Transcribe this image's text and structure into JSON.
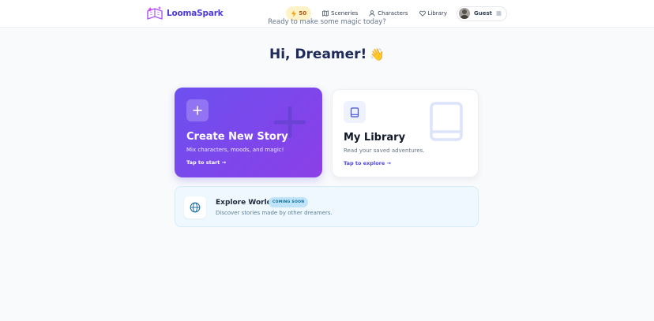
{
  "app": {
    "name": "LoomaSpark"
  },
  "header": {
    "energy_count": "50",
    "nav": [
      {
        "label": "Sceneries",
        "icon": "map-icon"
      },
      {
        "label": "Characters",
        "icon": "user-icon"
      },
      {
        "label": "Library",
        "icon": "heart-icon"
      }
    ],
    "user": {
      "name": "Guest",
      "menu_icon": "hamburger-icon"
    }
  },
  "greeting": {
    "title": "Hi, Dreamer!",
    "emoji": "👋",
    "subtitle": "Ready to make some magic today?"
  },
  "cards": {
    "create": {
      "title": "Create New Story",
      "description": "Mix characters, moods, and magic!",
      "cta": "Tap to start →",
      "icon": "plus-icon"
    },
    "library": {
      "title": "My Library",
      "description": "Read your saved adventures.",
      "cta": "Tap to explore →",
      "icon": "book-icon"
    }
  },
  "explore": {
    "title": "Explore Worlds",
    "badge": "COMING SOON",
    "description": "Discover stories made by other dreamers.",
    "icon": "globe-icon"
  },
  "colors": {
    "brand": "#4c3ad6",
    "create_gradient_start": "#6d50f0",
    "create_gradient_end": "#8b3fe6",
    "library_accent": "#4f46e5",
    "energy_bg": "#fef3c7",
    "explore_bg": "#eff8ff"
  }
}
